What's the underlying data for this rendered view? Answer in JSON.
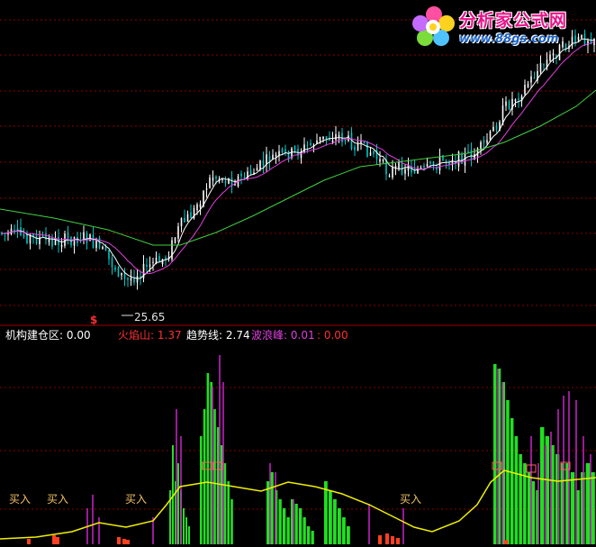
{
  "watermark": {
    "brand": "分析家公式网",
    "url": "www.88gs.com"
  },
  "main_chart": {
    "low_marker": "25.65",
    "signal_marker": "$",
    "colors": {
      "up": "#ffffff",
      "down": "#00c8c8",
      "ma_fast": "#ffffff",
      "ma_mid": "#e040e0",
      "ma_slow": "#40d040",
      "grid": "#8b0000",
      "divider": "#9b0000"
    }
  },
  "indicator_header": {
    "items": [
      {
        "label": "机构建仓区:",
        "value": "0.00",
        "color": "#ffffff"
      },
      {
        "label": "火焰山:",
        "value": "1.37",
        "color": "#ff3030"
      },
      {
        "label": "趋势线:",
        "value": "2.74",
        "color": "#ffffff"
      },
      {
        "label": "波浪峰:",
        "value": "0.01",
        "color": "#e040e0"
      },
      {
        "label": "",
        "value": ": 0.00",
        "color": "#ff3030"
      }
    ]
  },
  "signals": {
    "buy_label": "买入",
    "buy_color": "#f0c060"
  },
  "chart_data": {
    "type": "candlestick",
    "title": "",
    "annotations": [
      "25.65",
      "$"
    ],
    "indicator_series": [
      {
        "name": "火焰山",
        "type": "bar",
        "color": "#20e020"
      },
      {
        "name": "波浪峰",
        "type": "bar",
        "color": "#c020c0"
      },
      {
        "name": "趋势线",
        "type": "line",
        "color": "#f0f000"
      }
    ]
  }
}
